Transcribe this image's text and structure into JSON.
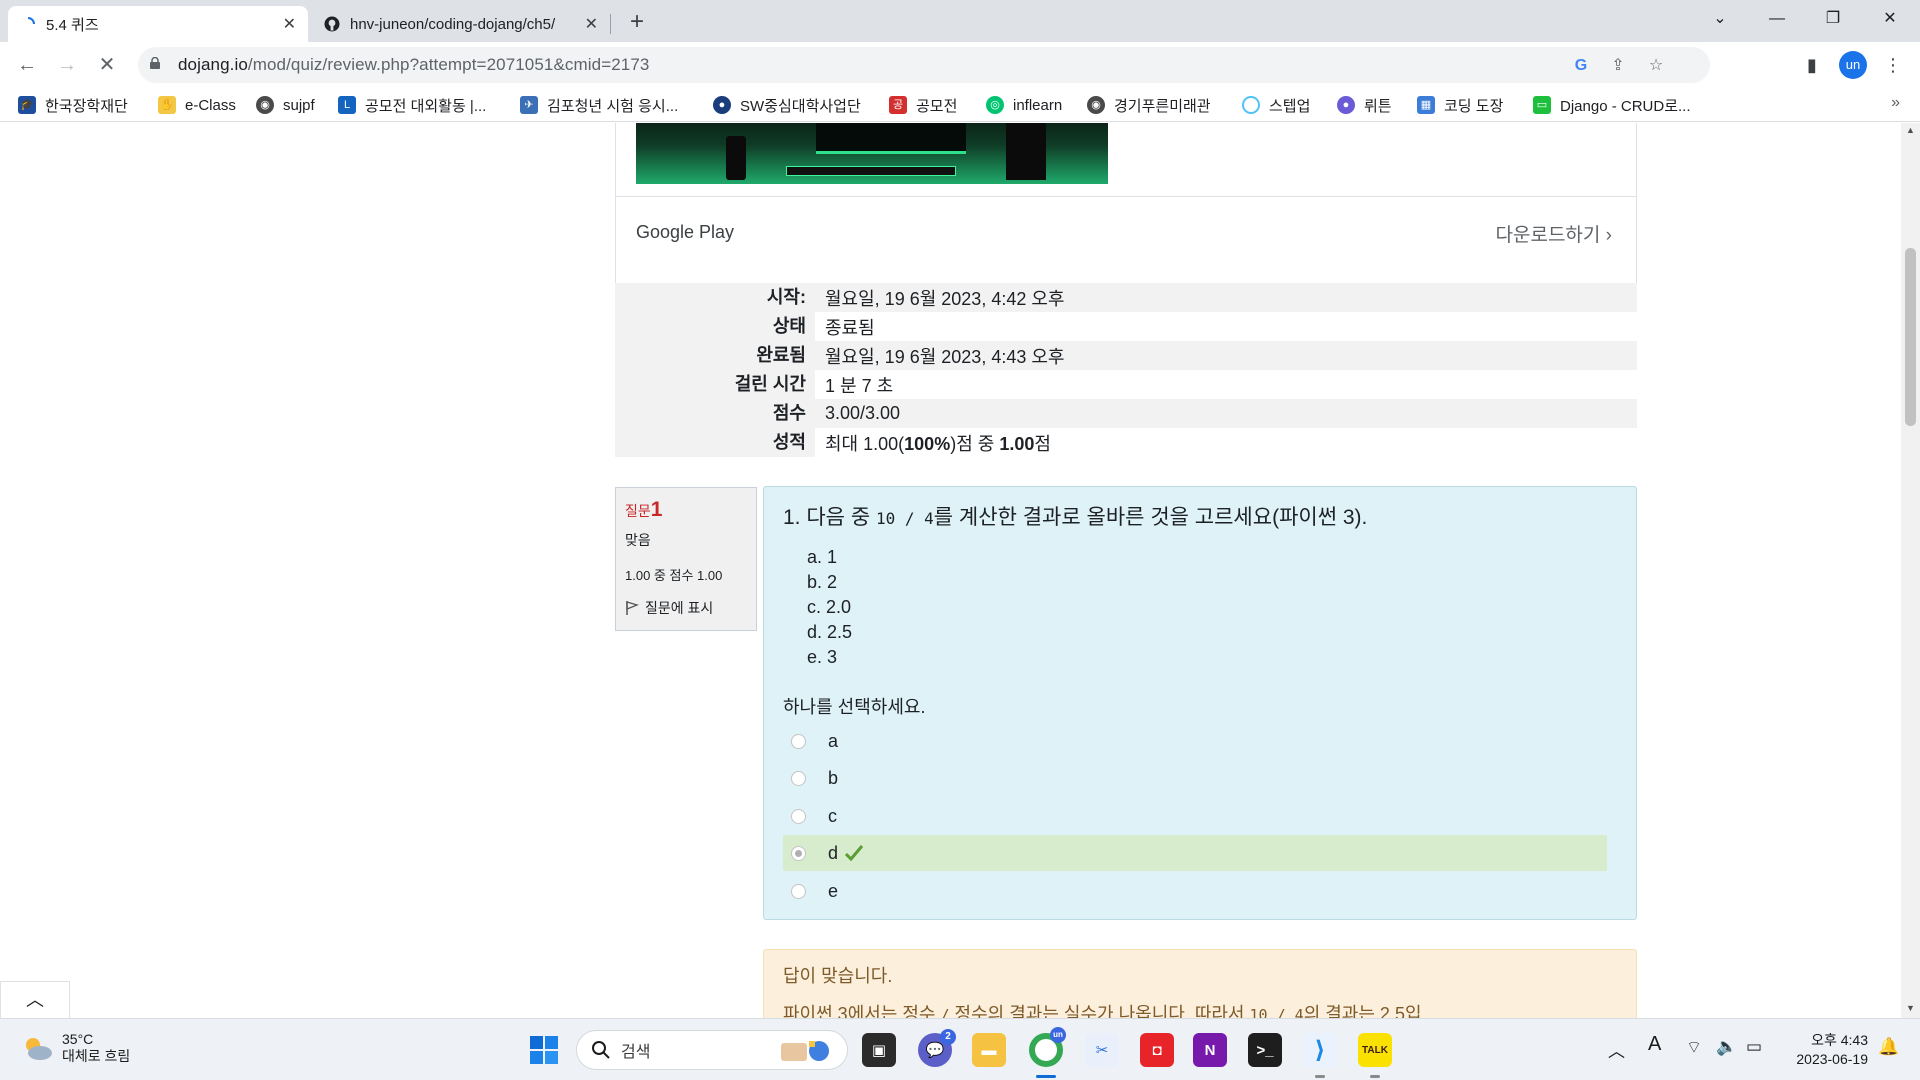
{
  "browser": {
    "tabs": [
      {
        "title": "5.4 퀴즈",
        "active": true
      },
      {
        "title": "hnv-juneon/coding-dojang/ch5/",
        "active": false
      }
    ],
    "url_host": "dojang.io",
    "url_path": "/mod/quiz/review.php?attempt=2071051&cmid=2173",
    "profile_initials": "un",
    "bookmarks": [
      "한국장학재단",
      "e-Class",
      "sujpf",
      "공모전 대외활동 |...",
      "김포청년 시험 응시...",
      "SW중심대학사업단",
      "공모전",
      "inflearn",
      "경기푸른미래관",
      "스텝업",
      "뤼튼",
      "코딩 도장",
      "Django - CRUD로..."
    ],
    "bookmark_more": "»"
  },
  "ad": {
    "store": "Google Play",
    "download": "다운로드하기 ›"
  },
  "summary": [
    {
      "label": "시작:",
      "value": "월요일, 19 6월 2023, 4:42 오후"
    },
    {
      "label": "상태",
      "value": "종료됨"
    },
    {
      "label": "완료됨",
      "value": "월요일, 19 6월 2023, 4:43 오후"
    },
    {
      "label": "걸린 시간",
      "value": "1 분 7 초"
    },
    {
      "label": "점수",
      "value": "3.00/3.00"
    },
    {
      "label": "성적",
      "value_pre": "최대 1.00(",
      "value_bold1": "100%",
      "value_mid": ")점 중 ",
      "value_bold2": "1.00",
      "value_post": "점"
    }
  ],
  "question": {
    "info_label": "질문",
    "number": "1",
    "state": "맞음",
    "grade": "1.00 중 점수 1.00",
    "flag": "질문에 표시",
    "text_pre": "1. 다음 중 ",
    "text_code": "10 / 4",
    "text_post": "를 계산한 결과로 올바른 것을 고르세요(파이썬 3).",
    "choices": [
      "a. 1",
      "b. 2",
      "c. 2.0",
      "d. 2.5",
      "e. 3"
    ],
    "prompt": "하나를 선택하세요.",
    "answers": [
      "a",
      "b",
      "c",
      "d",
      "e"
    ],
    "selected": "d",
    "correct_color": "#d7eccd"
  },
  "feedback": {
    "head": "답이 맞습니다.",
    "text_pre": "파이썬 3에서는 정수 ",
    "text_code1": "/",
    "text_mid": " 정수의 결과는 실수가 나옵니다. 따라서 ",
    "text_code2": "10 / 4",
    "text_post": "의 결과는 2.5입"
  },
  "taskbar": {
    "weather_temp": "35°C",
    "weather_cond": "대체로 흐림",
    "search_placeholder": "검색",
    "chat_badge": "2",
    "chrome_badge": "un",
    "time": "오후 4:43",
    "date": "2023-06-19"
  },
  "colors": {
    "question_bg": "#def2f8",
    "feedback_bg": "#fcefdc",
    "incorrect_red": "#c82828",
    "check_green": "#5a9e32"
  }
}
